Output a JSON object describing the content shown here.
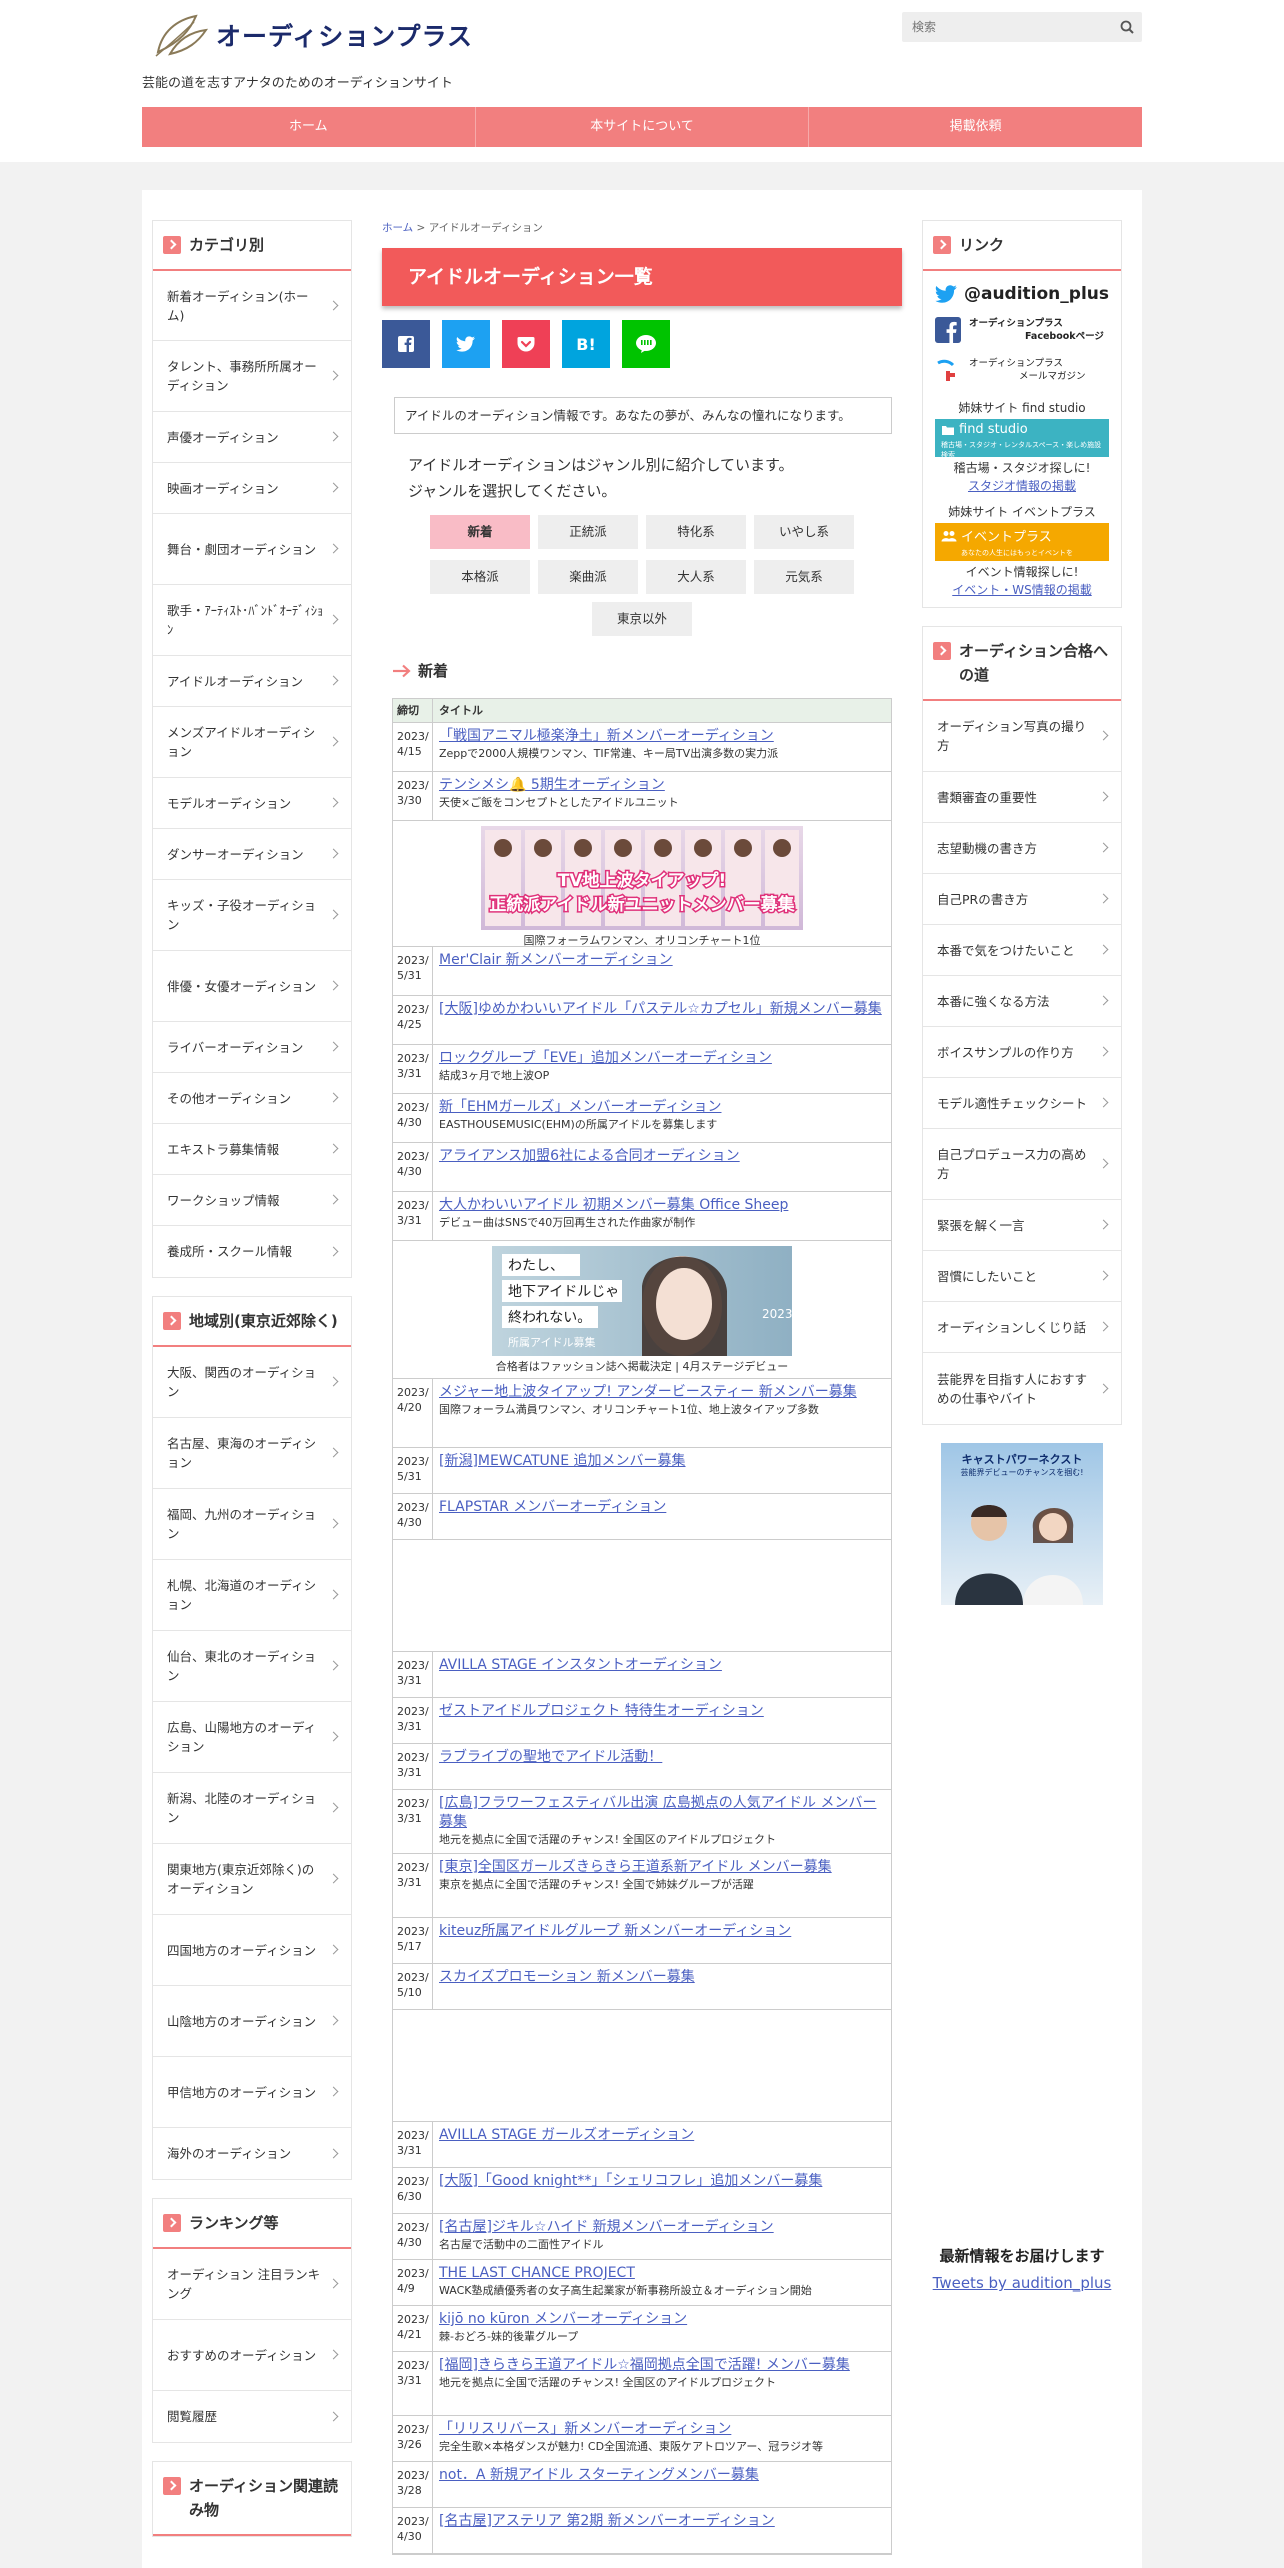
{
  "site": {
    "logo": "オーディションプラス",
    "tagline": "芸能の道を志すアナタのためのオーディションサイト",
    "search_placeholder": "検索"
  },
  "nav": [
    "ホーム",
    "本サイトについて",
    "掲載依頼"
  ],
  "breadcrumb": {
    "home": "ホーム",
    "sep": ">",
    "current": "アイドルオーディション"
  },
  "page_title": "アイドルオーディション一覧",
  "share": {
    "hatena": "B!"
  },
  "intro": "アイドルのオーディション情報です。あなたの夢が、みんなの憧れになります。",
  "genre_text": [
    "アイドルオーディションはジャンル別に紹介しています。",
    "ジャンルを選択してください。"
  ],
  "genres": [
    "新着",
    "正統派",
    "特化系",
    "いやし系",
    "本格派",
    "楽曲派",
    "大人系",
    "元気系",
    "東京以外"
  ],
  "section_title": "新着",
  "table_head": {
    "deadline": "締切",
    "title": "タイトル"
  },
  "rows1": [
    {
      "date": "2023/ 4/15",
      "title": "「戦国アニマル極楽浄土」新メンバーオーディション",
      "desc": "Zeppで2000人規模ワンマン、TIF常連、キー局TV出演多数の実力派"
    },
    {
      "date": "2023/ 3/30",
      "title": "テンシメシ🔔 5期生オーディション",
      "desc": "天使×ご飯をコンセプトとしたアイドルユニット"
    }
  ],
  "banner1": {
    "line1": "TV地上波タイアップ!",
    "line2": "正統派アイドル新ユニットメンバー募集",
    "caption": "国際フォーラムワンマン、オリコンチャート1位"
  },
  "rows2": [
    {
      "date": "2023/ 5/31",
      "title": "Mer'Clair 新メンバーオーディション",
      "desc": ""
    },
    {
      "date": "2023/ 4/25",
      "title": "[大阪]ゆめかわいいアイドル「パステル☆カプセル」新規メンバー募集",
      "desc": ""
    },
    {
      "date": "2023/ 3/31",
      "title": "ロックグループ「EVE」追加メンバーオーディション",
      "desc": "結成3ヶ月で地上波OP"
    },
    {
      "date": "2023/ 4/30",
      "title": "新「EHMガールズ」メンバーオーディション",
      "desc": "EASTHOUSEMUSIC(EHM)の所属アイドルを募集します"
    },
    {
      "date": "2023/ 4/30",
      "title": "アライアンス加盟6社による合同オーディション",
      "desc": ""
    },
    {
      "date": "2023/ 3/31",
      "title": "大人かわいいアイドル 初期メンバー募集 Office Sheep",
      "desc": "デビュー曲はSNSで40万回再生された作曲家が制作"
    }
  ],
  "banner2": {
    "line1": "わたし、",
    "line2": "地下アイドルじゃ",
    "line3": "終われない。",
    "line4": "2023",
    "line5": "所属アイドル募集",
    "caption": "合格者はファッション誌へ掲載決定 | 4月ステージデビュー"
  },
  "rows3": [
    {
      "date": "2023/ 4/20",
      "title": "メジャー地上波タイアップ! アンダービースティー 新メンバー募集",
      "desc": "国際フォーラム満員ワンマン、オリコンチャート1位、地上波タイアップ多数"
    },
    {
      "date": "2023/ 5/31",
      "title": "[新潟]MEWCATUNE 追加メンバー募集",
      "desc": ""
    },
    {
      "date": "2023/ 4/30",
      "title": "FLAPSTAR メンバーオーディション",
      "desc": ""
    }
  ],
  "rows4": [
    {
      "date": "2023/ 3/31",
      "title": "AVILLA STAGE インスタントオーディション",
      "desc": ""
    },
    {
      "date": "2023/ 3/31",
      "title": "ゼストアイドルプロジェクト 特待生オーディション",
      "desc": ""
    },
    {
      "date": "2023/ 3/31",
      "title": "ラブライブの聖地でアイドル活動！",
      "desc": ""
    },
    {
      "date": "2023/ 3/31",
      "title": "[広島]フラワーフェスティバル出演 広島拠点の人気アイドル メンバー募集",
      "desc": "地元を拠点に全国で活躍のチャンス! 全国区のアイドルプロジェクト"
    },
    {
      "date": "2023/ 3/31",
      "title": "[東京]全国区ガールズきらきら王道系新アイドル メンバー募集",
      "desc": "東京を拠点に全国で活躍のチャンス! 全国で姉妹グループが活躍"
    },
    {
      "date": "2023/ 5/17",
      "title": "kiteuz所属アイドルグループ 新メンバーオーディション",
      "desc": ""
    },
    {
      "date": "2023/ 5/10",
      "title": "スカイズプロモーション 新メンバー募集",
      "desc": ""
    }
  ],
  "rows5": [
    {
      "date": "2023/ 3/31",
      "title": "AVILLA STAGE ガールズオーディション",
      "desc": ""
    },
    {
      "date": "2023/ 6/30",
      "title": "[大阪]「Good knight**」「シェリコフレ」追加メンバー募集",
      "desc": ""
    },
    {
      "date": "2023/ 4/30",
      "title": "[名古屋]ジキル☆ハイド 新規メンバーオーディション",
      "desc": "名古屋で活動中の二面性アイドル"
    },
    {
      "date": "2023/ 4/9",
      "title": "THE LAST CHANCE PROJECT",
      "desc": "WACK塾成績優秀者の女子高生起業家が新事務所設立＆オーディション開始"
    },
    {
      "date": "2023/ 4/21",
      "title": "kijō no kūron メンバーオーディション",
      "desc": "棘-おどろ-妹的後輩グループ"
    },
    {
      "date": "2023/ 3/31",
      "title": "[福岡]きらきら王道アイドル☆福岡拠点全国で活躍! メンバー募集",
      "desc": "地元を拠点に全国で活躍のチャンス! 全国区のアイドルプロジェクト"
    },
    {
      "date": "2023/ 3/26",
      "title": "「リリスリバース」新メンバーオーディション",
      "desc": "完全生歌×本格ダンスが魅力! CD全国流通、東阪ケアトロツアー、冠ラジオ等"
    },
    {
      "date": "2023/ 3/28",
      "title": "not．A 新規アイドル スターティングメンバー募集",
      "desc": ""
    },
    {
      "date": "2023/ 4/30",
      "title": "[名古屋]アステリア 第2期 新メンバーオーディション",
      "desc": ""
    }
  ],
  "left": {
    "category_title": "カテゴリ別",
    "categories": [
      "新着オーディション(ホーム)",
      "タレント、事務所所属オーディション",
      "声優オーディション",
      "映画オーディション",
      "舞台・劇団オーディション",
      "歌手・ｱｰﾃｨｽﾄ･ﾊﾞﾝﾄﾞｵｰﾃﾞｨｼｮﾝ",
      "アイドルオーディション",
      "メンズアイドルオーディション",
      "モデルオーディション",
      "ダンサーオーディション",
      "キッズ・子役オーディション",
      "俳優・女優オーディション",
      "ライバーオーディション",
      "その他オーディション",
      "エキストラ募集情報",
      "ワークショップ情報",
      "養成所・スクール情報"
    ],
    "region_title": "地域別(東京近郊除く)",
    "regions": [
      "大阪、関西のオーディション",
      "名古屋、東海のオーディション",
      "福岡、九州のオーディション",
      "札幌、北海道のオーディション",
      "仙台、東北のオーディション",
      "広島、山陽地方のオーディション",
      "新潟、北陸のオーディション",
      "関東地方(東京近郊除く)のオーディション",
      "四国地方のオーディション",
      "山陰地方のオーディション",
      "甲信地方のオーディション",
      "海外のオーディション"
    ],
    "ranking_title": "ランキング等",
    "ranking": [
      "オーディション 注目ランキング",
      "おすすめのオーディション",
      "閲覧履歴"
    ],
    "related_title": "オーディション関連読み物"
  },
  "right": {
    "link_title": "リンク",
    "twitter_handle": "@audition_plus",
    "fb_line1": "オーディションプラス",
    "fb_line2": "Facebookページ",
    "mail_line1": "オーディションプラス",
    "mail_line2": "メールマガジン",
    "findstudio_head": "姉妹サイト find studio",
    "findstudio_name": "find studio",
    "findstudio_sub": "稽古場・スタジオ・レンタルスペース・楽しめ施設検索",
    "findstudio_text": "稽古場・スタジオ探しに!",
    "findstudio_link": "スタジオ情報の掲載",
    "eventplus_head": "姉妹サイト イベントプラス",
    "eventplus_name": "イベントプラス",
    "eventplus_sub": "あなたの人生にはもっとイベントを",
    "eventplus_text": "イベント情報探しに!",
    "eventplus_link": "イベント・WS情報の掲載",
    "guide_title": "オーディション合格への道",
    "guide": [
      "オーディション写真の撮り方",
      "書類審査の重要性",
      "志望動機の書き方",
      "自己PRの書き方",
      "本番で気をつけたいこと",
      "本番に強くなる方法",
      "ボイスサンプルの作り方",
      "モデル適性チェックシート",
      "自己プロデュース力の高め方",
      "緊張を解く一言",
      "習慣にしたいこと",
      "オーディションしくじり話",
      "芸能界を目指す人におすすめの仕事やバイト"
    ],
    "ad_title": "キャストパワーネクスト",
    "ad_sub": "芸能界デビューのチャンスを掴む!",
    "latest_text": "最新情報をお届けします",
    "tweets_link": "Tweets by audition_plus"
  }
}
